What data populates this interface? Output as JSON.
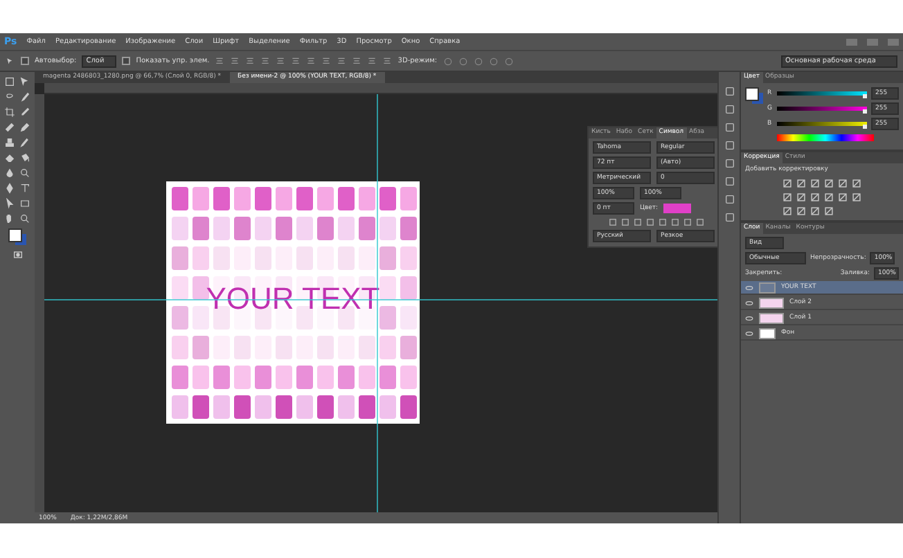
{
  "menu": {
    "logo": "Ps",
    "items": [
      "Файл",
      "Редактирование",
      "Изображение",
      "Слои",
      "Шрифт",
      "Выделение",
      "Фильтр",
      "3D",
      "Просмотр",
      "Окно",
      "Справка"
    ]
  },
  "options": {
    "autoselect_checked": false,
    "show_controls_checked": false,
    "autoselect_label": "Автовыбор:",
    "layer_select": "Слой",
    "show_controls": "Показать упр. элем.",
    "mode_3d": "3D-режим:",
    "workspace": "Основная рабочая среда"
  },
  "doc_tabs": [
    {
      "label": "magenta 2486803_1280.png @ 66,7% (Слой 0, RGB/8) *",
      "selected": false
    },
    {
      "label": "Без имени-2 @ 100% (YOUR TEXT, RGB/8) *",
      "selected": true
    }
  ],
  "canvas": {
    "text": "YOUR TEXT"
  },
  "status": {
    "zoom": "100%",
    "doc": "Док: 1,22М/2,86М"
  },
  "color_panel": {
    "tabs": [
      {
        "label": "Цвет",
        "selected": true
      },
      {
        "label": "Образцы",
        "selected": false
      }
    ],
    "channels": [
      {
        "name": "R",
        "value": "255",
        "level": 1
      },
      {
        "name": "G",
        "value": "255",
        "level": 1
      },
      {
        "name": "B",
        "value": "255",
        "level": 1
      }
    ]
  },
  "adjustments": {
    "tabs": [
      {
        "label": "Коррекция",
        "selected": true
      },
      {
        "label": "Стили",
        "selected": false
      }
    ],
    "hint": "Добавить корректировку"
  },
  "character": {
    "tabs": [
      {
        "label": "Кисть",
        "selected": false
      },
      {
        "label": "Набо",
        "selected": false
      },
      {
        "label": "Сетк",
        "selected": false
      },
      {
        "label": "Символ",
        "selected": true
      },
      {
        "label": "Абза",
        "selected": false
      }
    ],
    "font": "Tahoma",
    "style": "Regular",
    "size": "72 пт",
    "leading": "(Авто)",
    "kerning": "Метрический",
    "tracking": "0",
    "vscale": "100%",
    "hscale": "100%",
    "baseline": "0 пт",
    "color_label": "Цвет:",
    "color": "#e040c8",
    "language": "Русский",
    "antialias": "Резкое"
  },
  "layers": {
    "tabs": [
      {
        "label": "Слои",
        "selected": true
      },
      {
        "label": "Каналы",
        "selected": false
      },
      {
        "label": "Контуры",
        "selected": false
      }
    ],
    "filter": "Вид",
    "blend": "Обычные",
    "opacity_label": "Непрозрачность:",
    "opacity": "100%",
    "lock_label": "Закрепить:",
    "fill_label": "Заливка:",
    "fill": "100%",
    "items": [
      {
        "name": "YOUR TEXT",
        "kind": "text",
        "selected": true
      },
      {
        "name": "Слой 2",
        "kind": "layer",
        "selected": false
      },
      {
        "name": "Слой 1",
        "kind": "layer",
        "selected": false
      },
      {
        "name": "Фон",
        "kind": "background",
        "selected": false
      }
    ]
  }
}
